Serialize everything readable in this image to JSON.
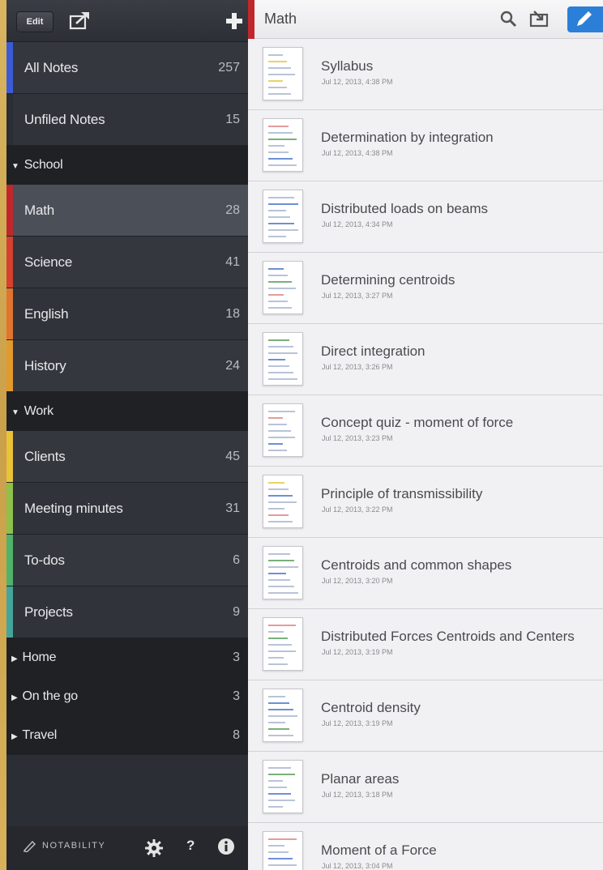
{
  "sidebar": {
    "toolbar": {
      "edit_label": "Edit"
    },
    "rows": [
      {
        "type": "note",
        "label": "All Notes",
        "count": "257",
        "color": "#3b5bd6"
      },
      {
        "type": "note",
        "label": "Unfiled Notes",
        "count": "15",
        "color": "#2b2e34"
      },
      {
        "type": "group",
        "label": "School",
        "count": ""
      },
      {
        "type": "note",
        "label": "Math",
        "count": "28",
        "color": "#c0272d",
        "selected": true
      },
      {
        "type": "note",
        "label": "Science",
        "count": "41",
        "color": "#d5402f"
      },
      {
        "type": "note",
        "label": "English",
        "count": "18",
        "color": "#e2742e"
      },
      {
        "type": "note",
        "label": "History",
        "count": "24",
        "color": "#e39a2c"
      },
      {
        "type": "group",
        "label": "Work",
        "count": ""
      },
      {
        "type": "note",
        "label": "Clients",
        "count": "45",
        "color": "#e9c23a"
      },
      {
        "type": "note",
        "label": "Meeting minutes",
        "count": "31",
        "color": "#8fc04a"
      },
      {
        "type": "note",
        "label": "To-dos",
        "count": "6",
        "color": "#4fb36a"
      },
      {
        "type": "note",
        "label": "Projects",
        "count": "9",
        "color": "#43a59c"
      },
      {
        "type": "group",
        "label": "Home",
        "count": "3"
      },
      {
        "type": "group",
        "label": "On the go",
        "count": "3"
      },
      {
        "type": "group",
        "label": "Travel",
        "count": "8"
      }
    ],
    "footer": {
      "brand": "NOTABILITY",
      "help": "?"
    }
  },
  "main": {
    "title": "Math",
    "accent_color": "#c0272d",
    "notes": [
      {
        "title": "Syllabus",
        "date": "Jul 12, 2013, 4:38 PM"
      },
      {
        "title": "Determination by integration",
        "date": "Jul 12, 2013, 4:38 PM"
      },
      {
        "title": "Distributed loads on beams",
        "date": "Jul 12, 2013, 4:34 PM"
      },
      {
        "title": "Determining centroids",
        "date": "Jul 12, 2013, 3:27 PM"
      },
      {
        "title": "Direct integration",
        "date": "Jul 12, 2013, 3:26 PM"
      },
      {
        "title": "Concept quiz - moment of force",
        "date": "Jul 12, 2013, 3:23 PM"
      },
      {
        "title": "Principle of transmissibility",
        "date": "Jul 12, 2013, 3:22 PM"
      },
      {
        "title": "Centroids and common shapes",
        "date": "Jul 12, 2013, 3:20 PM"
      },
      {
        "title": "Distributed Forces Centroids and Centers",
        "date": "Jul 12, 2013, 3:19 PM"
      },
      {
        "title": "Centroid density",
        "date": "Jul 12, 2013, 3:19 PM"
      },
      {
        "title": "Planar areas",
        "date": "Jul 12, 2013, 3:18 PM"
      },
      {
        "title": "Moment of a Force",
        "date": "Jul 12, 2013, 3:04 PM"
      }
    ]
  }
}
